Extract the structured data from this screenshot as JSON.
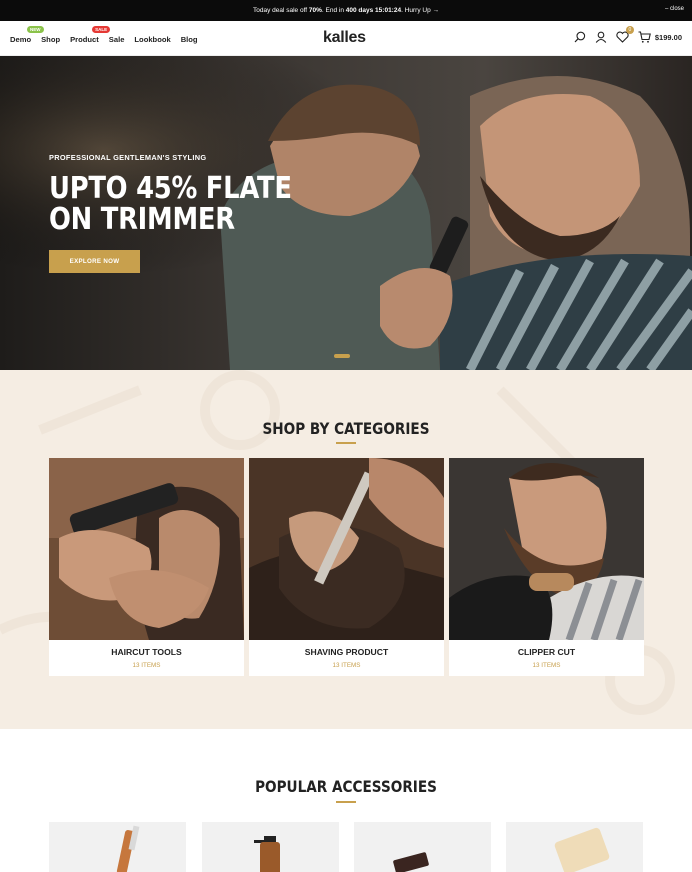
{
  "announcement": {
    "prefix": "Today deal sale off",
    "percent": "70%",
    "middle": ". End in",
    "countdown": "400 days 15:01:24",
    "suffix": ". Hurry Up →",
    "close": "– close"
  },
  "header": {
    "logo": "kalles",
    "nav": [
      {
        "label": "Demo",
        "badge": "NEW"
      },
      {
        "label": "Shop"
      },
      {
        "label": "Product",
        "badge": "SALE"
      },
      {
        "label": "Sale"
      },
      {
        "label": "Lookbook"
      },
      {
        "label": "Blog"
      }
    ],
    "wishlist_count": "0",
    "cart_total": "$199.00",
    "icons": [
      "search-icon",
      "user-icon",
      "heart-icon",
      "cart-icon"
    ]
  },
  "hero": {
    "kicker": "PROFESSIONAL GENTLEMAN'S STYLING",
    "title_line1": "UPTO 45% FLATE",
    "title_line2": "ON TRIMMER",
    "button": "EXPLORE NOW"
  },
  "categories": {
    "title": "SHOP BY CATEGORIES",
    "items": [
      {
        "name": "HAIRCUT TOOLS",
        "count": "13 ITEMS"
      },
      {
        "name": "SHAVING PRODUCT",
        "count": "13 ITEMS"
      },
      {
        "name": "CLIPPER CUT",
        "count": "13 ITEMS"
      }
    ]
  },
  "accessories": {
    "title": "POPULAR ACCESSORIES"
  },
  "colors": {
    "accent": "#c8a04d",
    "topbar": "#0b0b0b",
    "categories_bg": "#f5ede3"
  }
}
